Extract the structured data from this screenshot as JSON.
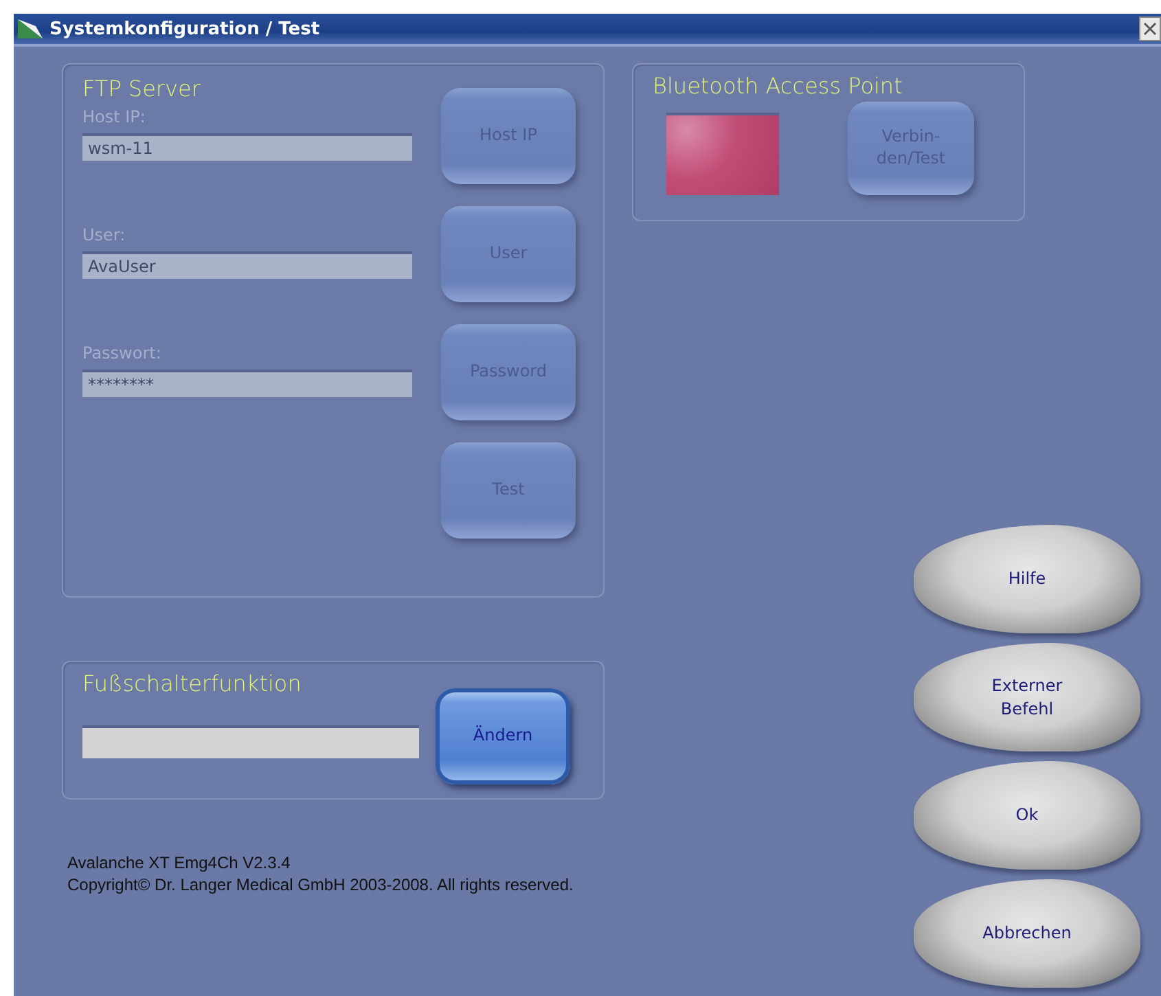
{
  "window": {
    "title": "Systemkonfiguration / Test"
  },
  "ftp_server": {
    "title": "FTP Server",
    "fields": [
      {
        "label": "Host IP:",
        "value": "wsm-11",
        "button": "Host IP",
        "disabled": true
      },
      {
        "label": "User:",
        "value": "AvaUser",
        "button": "User",
        "disabled": true
      },
      {
        "label": "Passwort:",
        "value": "********",
        "button": "Password",
        "disabled": true
      }
    ],
    "test_button": {
      "label": "Test",
      "disabled": true
    }
  },
  "bluetooth": {
    "title": "Bluetooth Access Point",
    "connected": false,
    "button": {
      "label": "Verbin-\nden/Test",
      "disabled": true
    }
  },
  "footswitch": {
    "title": "Fußschalterfunktion",
    "button": {
      "label": "Ändern",
      "disabled": false
    }
  },
  "footer": [
    "Avalanche XT Emg4Ch V2.3.4",
    "Copyright© Dr. Langer Medical GmbH 2003-2008. All rights reserved."
  ],
  "actions": [
    "Hilfe",
    "Externer\nBefehl",
    "Ok",
    "Abbrechen"
  ]
}
